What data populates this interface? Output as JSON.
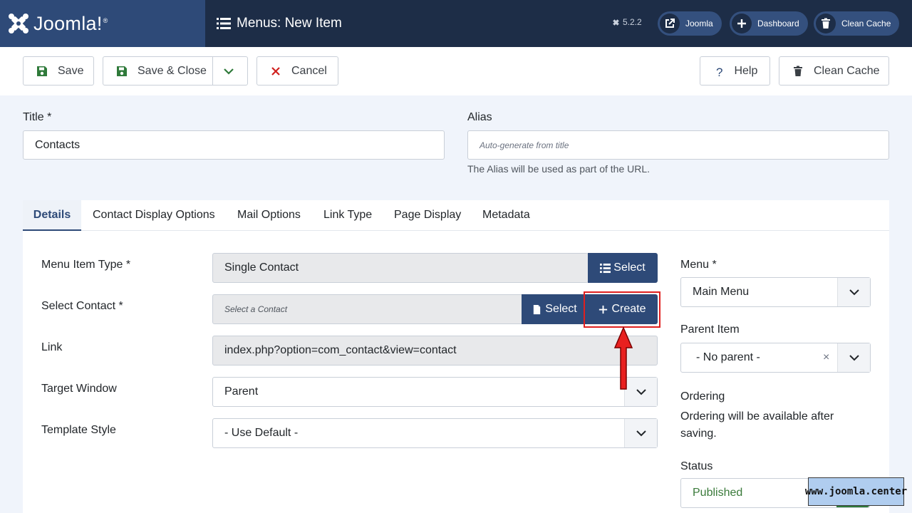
{
  "header": {
    "brand": "Joomla!",
    "page_title": "Menus: New Item",
    "version": "5.2.2",
    "buttons": [
      {
        "label": "Joomla",
        "icon": "external-link-icon"
      },
      {
        "label": "Dashboard",
        "icon": "plus-icon"
      },
      {
        "label": "Clean Cache",
        "icon": "trash-icon"
      }
    ]
  },
  "toolbar": {
    "save": "Save",
    "save_close": "Save & Close",
    "cancel": "Cancel",
    "help": "Help",
    "clean_cache": "Clean Cache"
  },
  "form": {
    "title_label": "Title *",
    "title_value": "Contacts",
    "alias_label": "Alias",
    "alias_placeholder": "Auto-generate from title",
    "alias_help": "The Alias will be used as part of the URL."
  },
  "tabs": [
    "Details",
    "Contact Display Options",
    "Mail Options",
    "Link Type",
    "Page Display",
    "Metadata"
  ],
  "details": {
    "menu_item_type_label": "Menu Item Type *",
    "menu_item_type_value": "Single Contact",
    "select_label": "Select",
    "select_contact_label": "Select Contact *",
    "select_contact_placeholder": "Select a Contact",
    "select_contact_button": "Select",
    "create_button": "Create",
    "link_label": "Link",
    "link_value": "index.php?option=com_contact&view=contact",
    "target_window_label": "Target Window",
    "target_window_value": "Parent",
    "template_style_label": "Template Style",
    "template_style_value": "- Use Default -"
  },
  "sidebar": {
    "menu_label": "Menu *",
    "menu_value": "Main Menu",
    "parent_label": "Parent Item",
    "parent_value": "- No parent -",
    "clear_symbol": "×",
    "ordering_label": "Ordering",
    "ordering_text": "Ordering will be available after saving.",
    "status_label": "Status",
    "status_value": "Published"
  },
  "watermark": "www.joomla.center",
  "colors": {
    "header_bg": "#1d2d47",
    "brand_bg": "#2e4a78",
    "accent": "#2e4a78",
    "highlight": "#e0201f"
  }
}
